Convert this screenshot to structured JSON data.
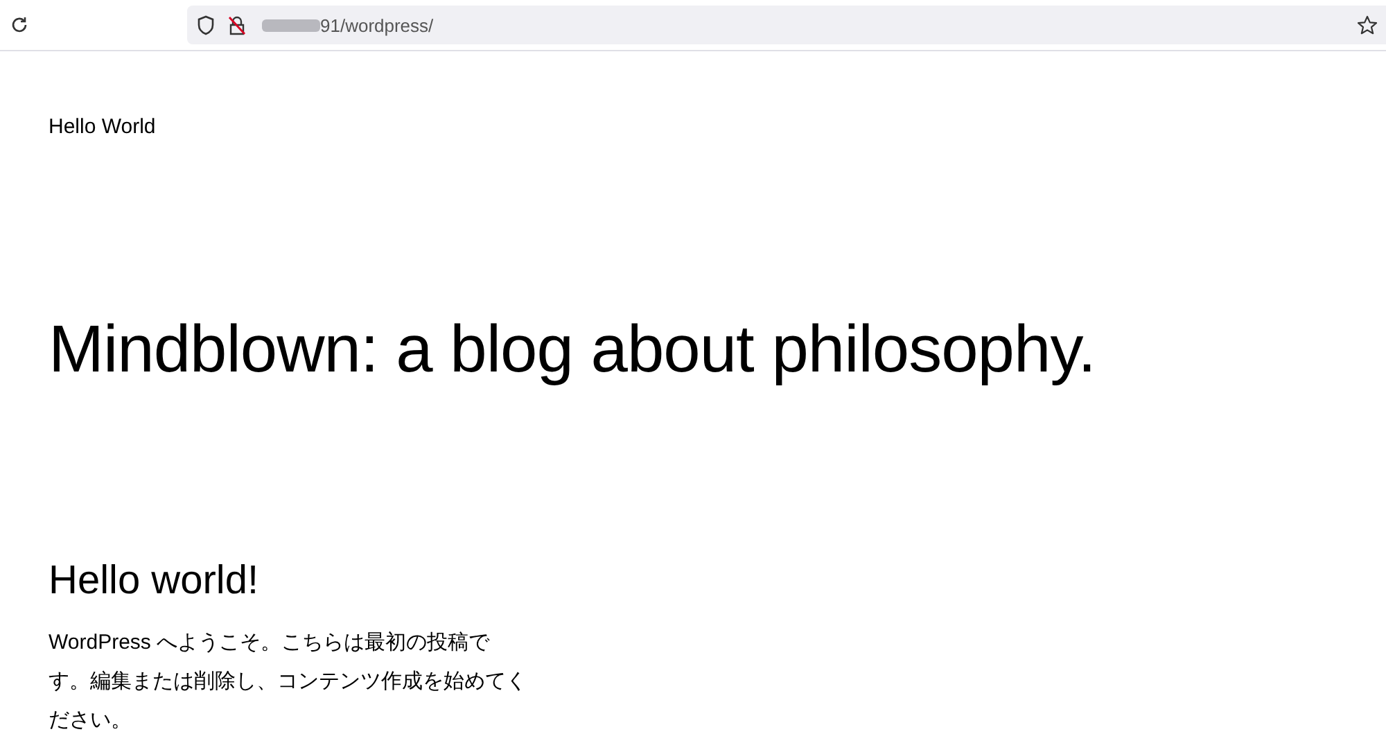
{
  "browser": {
    "url": "91/wordpress/"
  },
  "site": {
    "title": "Hello World"
  },
  "hero": {
    "heading": "Mindblown: a blog about philosophy."
  },
  "post": {
    "title": "Hello world!",
    "body": "WordPress へようこそ。こちらは最初の投稿です。編集または削除し、コンテンツ作成を始めてください。"
  }
}
